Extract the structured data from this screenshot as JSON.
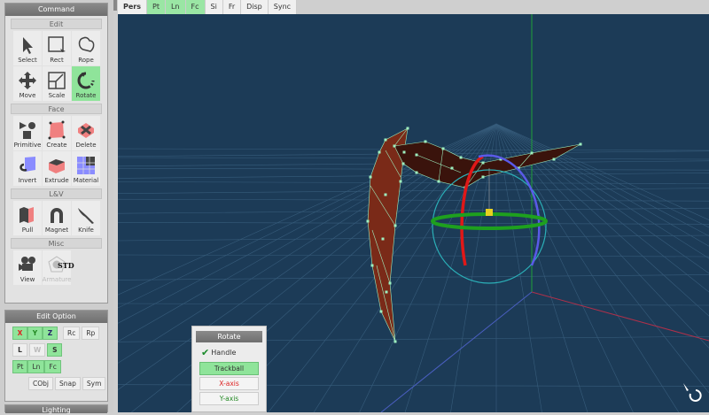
{
  "command": {
    "title": "Command",
    "sections": [
      {
        "title": "Edit",
        "tools": [
          {
            "label": "Select",
            "icon": "arrow-cursor-icon"
          },
          {
            "label": "Rect",
            "icon": "rect-select-icon"
          },
          {
            "label": "Rope",
            "icon": "lasso-icon"
          },
          {
            "label": "Move",
            "icon": "move-arrows-icon"
          },
          {
            "label": "Scale",
            "icon": "scale-icon"
          },
          {
            "label": "Rotate",
            "icon": "rotate-icon",
            "active": true
          }
        ]
      },
      {
        "title": "Face",
        "tools": [
          {
            "label": "Primitive",
            "icon": "primitive-shapes-icon"
          },
          {
            "label": "Create",
            "icon": "create-face-icon"
          },
          {
            "label": "Delete",
            "icon": "delete-face-icon"
          },
          {
            "label": "Invert",
            "icon": "invert-icon"
          },
          {
            "label": "Extrude",
            "icon": "extrude-icon"
          },
          {
            "label": "Material",
            "icon": "material-icon"
          }
        ]
      },
      {
        "title": "L&V",
        "tools": [
          {
            "label": "Pull",
            "icon": "pull-icon"
          },
          {
            "label": "Magnet",
            "icon": "magnet-icon"
          },
          {
            "label": "Knife",
            "icon": "knife-icon"
          }
        ]
      },
      {
        "title": "Misc",
        "tools": [
          {
            "label": "View",
            "icon": "camera-icon"
          },
          {
            "label": "Armature",
            "icon": "armature-icon",
            "badge": "STD",
            "disabled": true
          }
        ]
      }
    ]
  },
  "edit_option": {
    "title": "Edit Option",
    "axes": [
      "X",
      "Y",
      "Z"
    ],
    "rc": "Rc",
    "rp": "Rp",
    "l": "L",
    "w": "W",
    "s": "S",
    "pt": "Pt",
    "ln": "Ln",
    "fc": "Fc",
    "cobj": "CObj",
    "snap": "Snap",
    "sym": "Sym"
  },
  "lighting": {
    "title": "Lighting"
  },
  "tabs": [
    {
      "label": "Pers"
    },
    {
      "label": "Pt",
      "on": true
    },
    {
      "label": "Ln",
      "on": true
    },
    {
      "label": "Fc",
      "on": true
    },
    {
      "label": "Si"
    },
    {
      "label": "Fr"
    },
    {
      "label": "Disp"
    },
    {
      "label": "Sync"
    }
  ],
  "rotate_panel": {
    "title": "Rotate",
    "handle": "Handle",
    "handle_checked": true,
    "buttons": [
      "Trackball",
      "X-axis",
      "Y-axis"
    ]
  },
  "colors": {
    "viewport": "#1c3b57",
    "active": "#8fe49a",
    "mesh": "#7a2a18",
    "vertex": "#8ff0b0"
  }
}
